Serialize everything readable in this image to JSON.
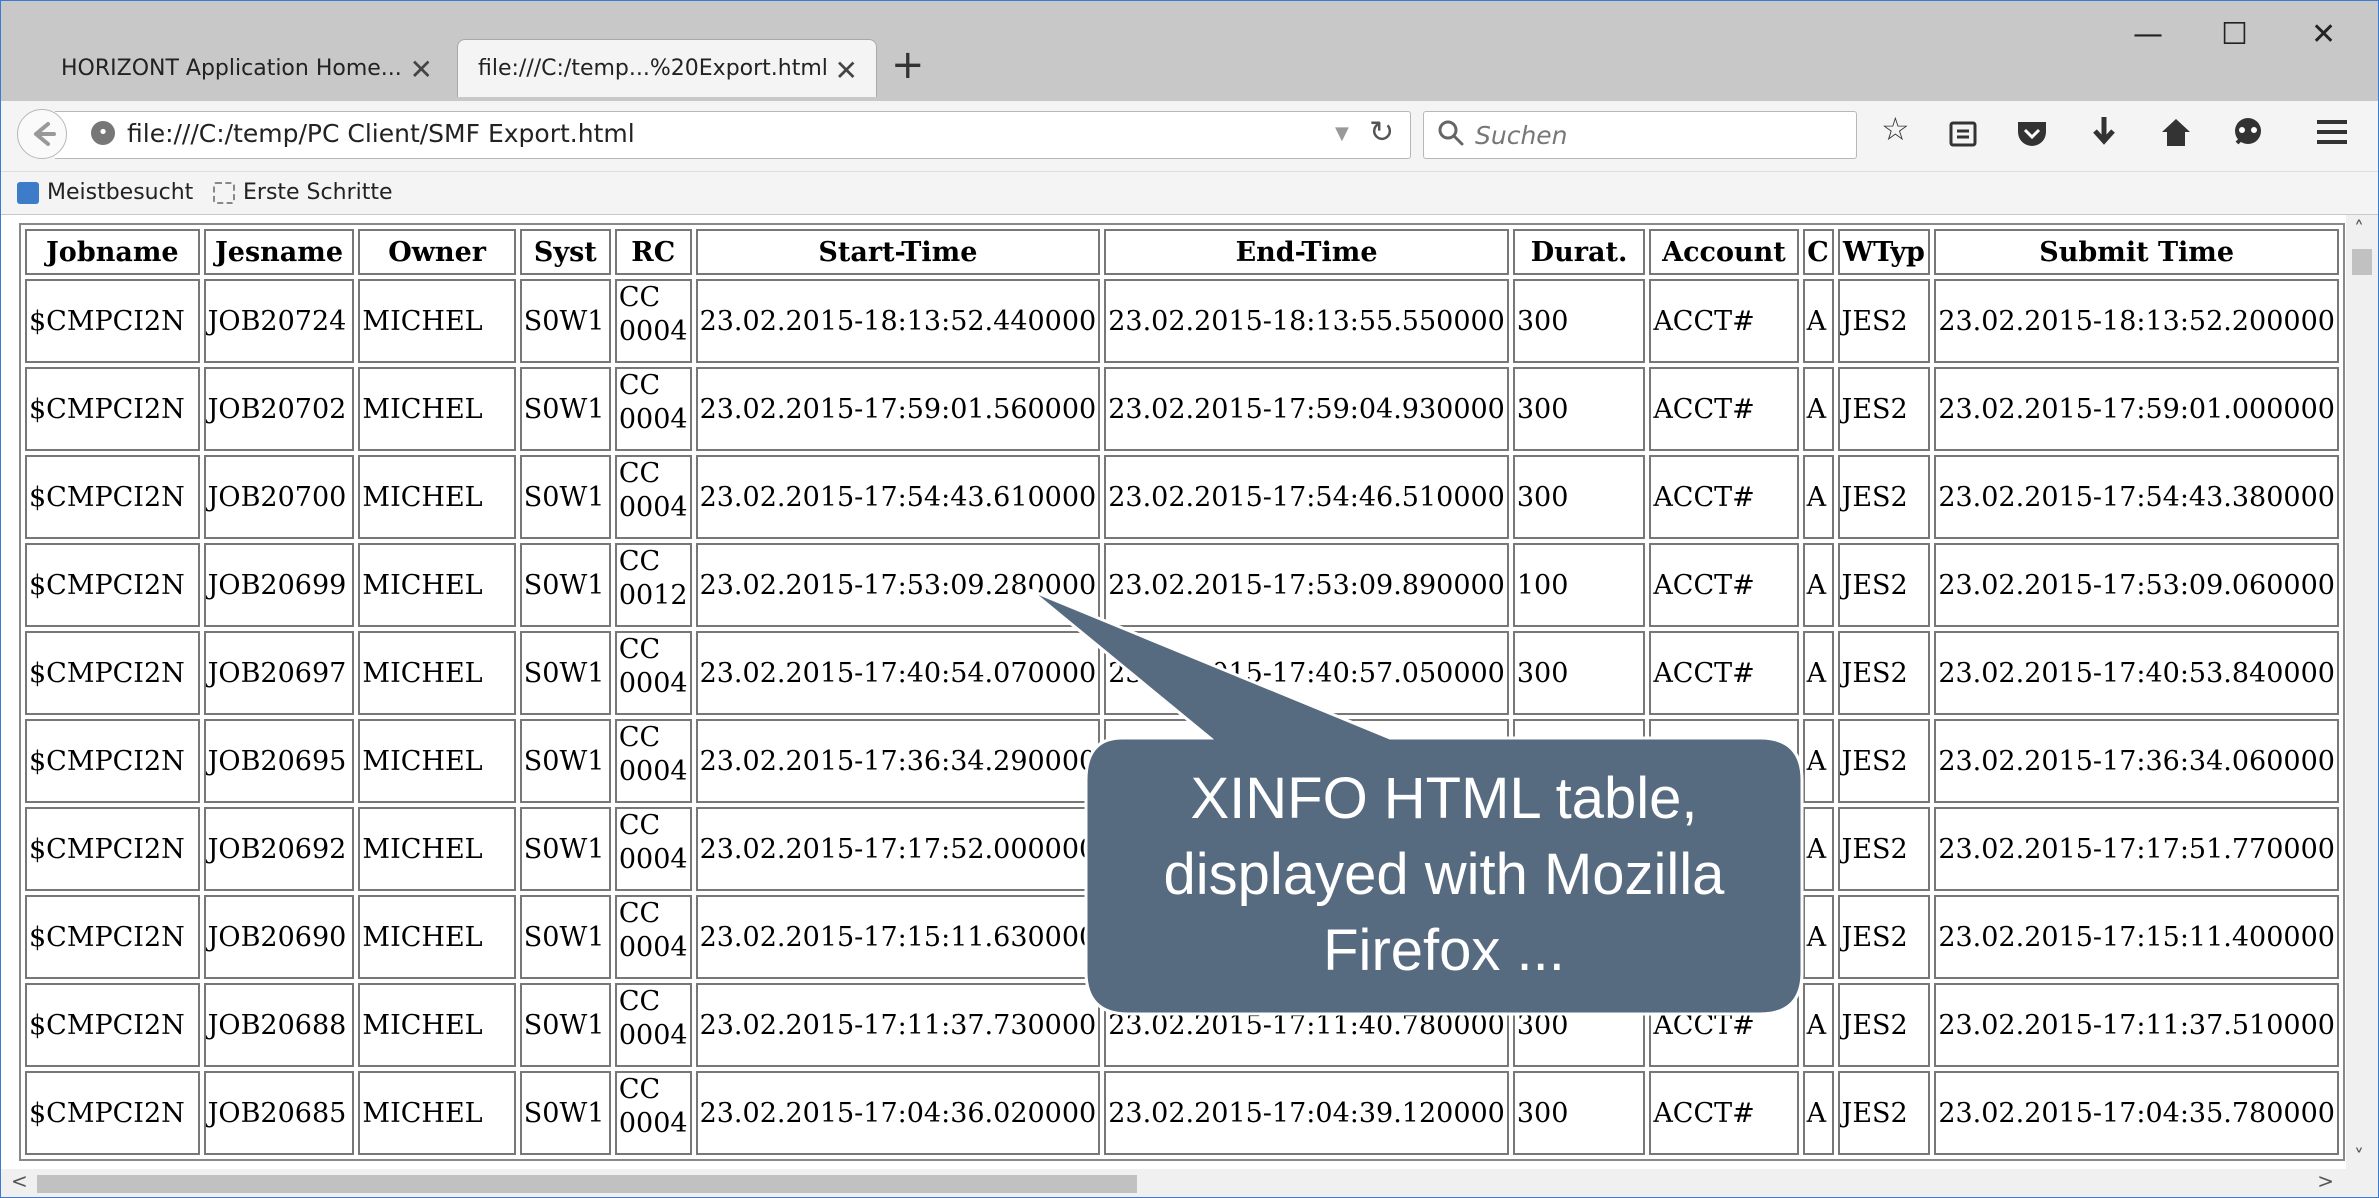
{
  "tabs": [
    {
      "title": "HORIZONT Application Home...",
      "close": "✕"
    },
    {
      "title": "file:///C:/temp...%20Export.html",
      "close": "✕"
    }
  ],
  "new_tab": "+",
  "window_controls": {
    "minimize": "—",
    "maximize": "☐",
    "close": "✕"
  },
  "nav": {
    "url": "file:///C:/temp/PC Client/SMF Export.html",
    "search_placeholder": "Suchen"
  },
  "bookmarks": [
    "Meistbesucht",
    "Erste Schritte"
  ],
  "table": {
    "headers": [
      "Jobname",
      "Jesname",
      "Owner",
      "Syst",
      "RC",
      "Start-Time",
      "End-Time",
      "Durat.",
      "Account",
      "C",
      "WTyp",
      "Submit Time"
    ],
    "rows": [
      [
        "$CMPCI2N",
        "JOB20724",
        "MICHEL",
        "S0W1",
        "CC",
        "0004",
        "23.02.2015-18:13:52.440000",
        "23.02.2015-18:13:55.550000",
        "300",
        "ACCT#",
        "A",
        "JES2",
        "23.02.2015-18:13:52.200000"
      ],
      [
        "$CMPCI2N",
        "JOB20702",
        "MICHEL",
        "S0W1",
        "CC",
        "0004",
        "23.02.2015-17:59:01.560000",
        "23.02.2015-17:59:04.930000",
        "300",
        "ACCT#",
        "A",
        "JES2",
        "23.02.2015-17:59:01.000000"
      ],
      [
        "$CMPCI2N",
        "JOB20700",
        "MICHEL",
        "S0W1",
        "CC",
        "0004",
        "23.02.2015-17:54:43.610000",
        "23.02.2015-17:54:46.510000",
        "300",
        "ACCT#",
        "A",
        "JES2",
        "23.02.2015-17:54:43.380000"
      ],
      [
        "$CMPCI2N",
        "JOB20699",
        "MICHEL",
        "S0W1",
        "CC",
        "0012",
        "23.02.2015-17:53:09.280000",
        "23.02.2015-17:53:09.890000",
        "100",
        "ACCT#",
        "A",
        "JES2",
        "23.02.2015-17:53:09.060000"
      ],
      [
        "$CMPCI2N",
        "JOB20697",
        "MICHEL",
        "S0W1",
        "CC",
        "0004",
        "23.02.2015-17:40:54.070000",
        "23.02.2015-17:40:57.050000",
        "300",
        "ACCT#",
        "A",
        "JES2",
        "23.02.2015-17:40:53.840000"
      ],
      [
        "$CMPCI2N",
        "JOB20695",
        "MICHEL",
        "S0W1",
        "CC",
        "0004",
        "23.02.2015-17:36:34.290000",
        "",
        "",
        "",
        "A",
        "JES2",
        "23.02.2015-17:36:34.060000"
      ],
      [
        "$CMPCI2N",
        "JOB20692",
        "MICHEL",
        "S0W1",
        "CC",
        "0004",
        "23.02.2015-17:17:52.000000",
        "",
        "",
        "",
        "A",
        "JES2",
        "23.02.2015-17:17:51.770000"
      ],
      [
        "$CMPCI2N",
        "JOB20690",
        "MICHEL",
        "S0W1",
        "CC",
        "0004",
        "23.02.2015-17:15:11.630000",
        "",
        "",
        "",
        "A",
        "JES2",
        "23.02.2015-17:15:11.400000"
      ],
      [
        "$CMPCI2N",
        "JOB20688",
        "MICHEL",
        "S0W1",
        "CC",
        "0004",
        "23.02.2015-17:11:37.730000",
        "23.02.2015-17:11:40.780000",
        "300",
        "ACCT#",
        "A",
        "JES2",
        "23.02.2015-17:11:37.510000"
      ],
      [
        "$CMPCI2N",
        "JOB20685",
        "MICHEL",
        "S0W1",
        "CC",
        "0004",
        "23.02.2015-17:04:36.020000",
        "23.02.2015-17:04:39.120000",
        "300",
        "ACCT#",
        "A",
        "JES2",
        "23.02.2015-17:04:35.780000"
      ]
    ]
  },
  "callout": {
    "lines": [
      "XINFO HTML table,",
      "displayed with Mozilla",
      "Firefox ..."
    ],
    "color": "#566a80"
  },
  "icons": [
    "back-arrow-icon",
    "globe-icon",
    "dropdown-icon",
    "reload-icon",
    "search-icon",
    "bookmark-star-icon",
    "reading-list-icon",
    "pocket-icon",
    "download-icon",
    "home-icon",
    "chat-icon",
    "menu-icon"
  ]
}
